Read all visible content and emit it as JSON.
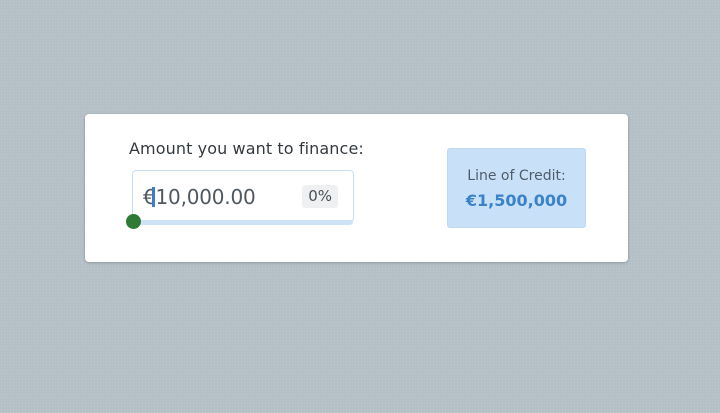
{
  "finance_form": {
    "amount_label": "Amount you want to finance:",
    "amount_value": "€10,000.00",
    "percent_badge": "0%",
    "slider": {
      "level_fraction": 0.0,
      "handle_color": "#2f7a34",
      "track_color": "#cfe3f6"
    }
  },
  "line_of_credit": {
    "label": "Line of Credit:",
    "value": "€1,500,000",
    "background_color": "#c8e1f8",
    "value_color": "#3b82c8"
  },
  "colors": {
    "page_background": "#b4c0c6",
    "card_background": "#ffffff",
    "caret": "#3d7dc9"
  }
}
